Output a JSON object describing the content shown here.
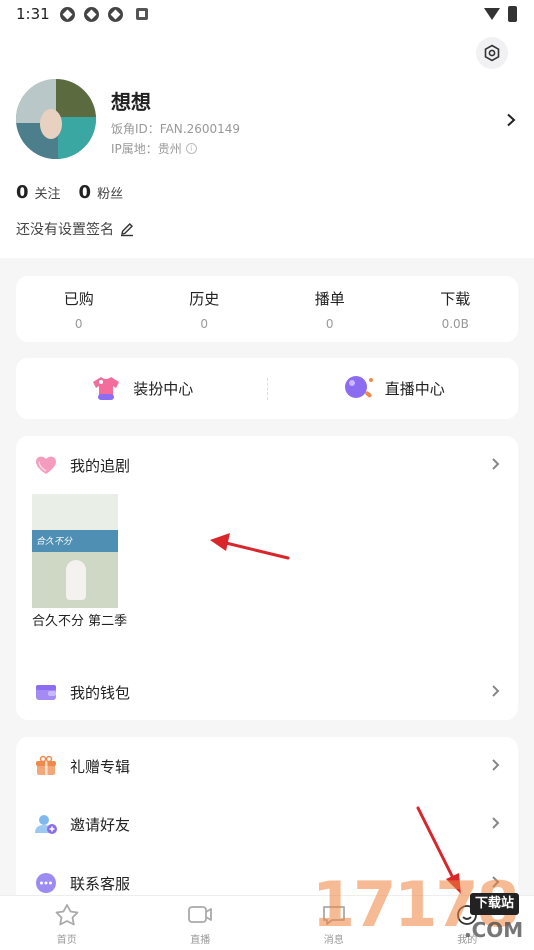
{
  "status_bar": {
    "time": "1:31"
  },
  "profile": {
    "name": "想想",
    "id_text": "饭角ID：FAN.2600149",
    "ip_text": "IP属地：贵州",
    "following_count": "0",
    "following_label": "关注",
    "fans_count": "0",
    "fans_label": "粉丝",
    "signature": "还没有设置签名"
  },
  "stats": [
    {
      "label": "已购",
      "value": "0"
    },
    {
      "label": "历史",
      "value": "0"
    },
    {
      "label": "播单",
      "value": "0"
    },
    {
      "label": "下载",
      "value": "0.0B"
    }
  ],
  "centers": [
    {
      "label": "装扮中心"
    },
    {
      "label": "直播中心"
    }
  ],
  "my_drama": {
    "label": "我的追剧",
    "items": [
      {
        "title": "合久不分 第二季",
        "poster_text": "合久不分"
      }
    ]
  },
  "wallet": {
    "label": "我的钱包"
  },
  "menu": [
    {
      "label": "礼赠专辑"
    },
    {
      "label": "邀请好友"
    },
    {
      "label": "联系客服"
    }
  ],
  "tabs": [
    {
      "label": "首页"
    },
    {
      "label": "直播"
    },
    {
      "label": "消息"
    },
    {
      "label": "我的"
    }
  ],
  "watermark": {
    "digits": "17178",
    "badge": "下载站",
    "suffix": ".COM"
  },
  "colors": {
    "accent_arrow": "#d8262b",
    "purple": "#8c6cf0",
    "pink": "#f46c9c",
    "orange": "#f08a4b"
  }
}
